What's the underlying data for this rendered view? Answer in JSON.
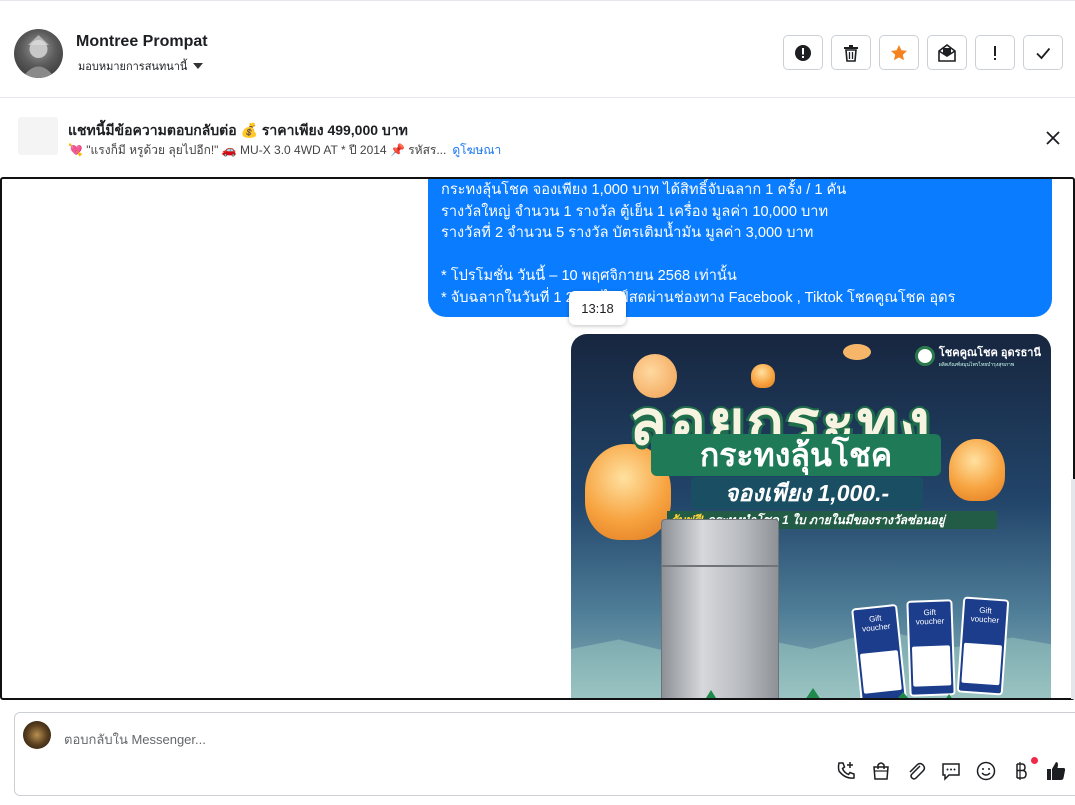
{
  "header": {
    "user_name": "Montree Prompat",
    "assign_label": "มอบหมายการสนทนานี้"
  },
  "actions": [
    {
      "name": "report-button",
      "icon": "alert-circle-icon"
    },
    {
      "name": "delete-button",
      "icon": "trash-icon"
    },
    {
      "name": "star-button",
      "icon": "star-icon",
      "color": "#f5821f"
    },
    {
      "name": "mark-unread-button",
      "icon": "mail-open-icon"
    },
    {
      "name": "important-button",
      "icon": "exclamation-icon"
    },
    {
      "name": "done-button",
      "icon": "check-icon"
    }
  ],
  "ad": {
    "title": "แชทนี้มีข้อความตอบกลับต่อ 💰 ราคาเพียง 499,000 บาท",
    "subtitle": "💘 \"แรงก็มี หรูด้วย ลุยไปอีก!\" 🚗 MU-X 3.0 4WD AT * ปี 2014 📌 รหัสร...",
    "link": "ดูโฆษณา"
  },
  "message": {
    "lines": [
      "กระทงลุ้นโชค จองเพียง 1,000 บาท ได้สิทธิ์จับฉลาก 1 ครั้ง /  1 คัน",
      "รางวัลใหญ่  จำนวน 1 รางวัล   ตู้เย็น 1  เครื่อง  มูลค่า    10,000  บาท",
      "รางวัลที่ 2  จำนวน 5 รางวัล   บัตรเติมน้ำมัน    มูลค่า    3,000   บาท",
      "",
      "* โปรโมชั่น วันนี้ – 10 พฤศจิกายน 2568 เท่านั้น",
      "* จับฉลากในวันที่ 1        2568 ไลฟ์สดผ่านช่องทาง Facebook , Tiktok โชคคูณโชค อุดร"
    ],
    "time": "13:18",
    "color": "#0a7cff"
  },
  "poster": {
    "brand": "โชคคูณโชค อุดรธานี",
    "brand_tag": "ผลิตภัณฑ์สมุนไพรไทยบำรุงสุขภาพ",
    "headline": "ลอยกระทง",
    "subheadline": "กระทงลุ้นโชค",
    "price": "จองเพียง 1,000.-",
    "free_word": "รับฟรี!",
    "free_text": "กระทงนำโชค 1 ใบ ภายในมีของรางวัลซ่อนอยู่",
    "voucher_label": "Gift voucher"
  },
  "composer": {
    "placeholder": "ตอบกลับใน Messenger..."
  },
  "tools": [
    "phone-add-icon",
    "bag-icon",
    "paperclip-icon",
    "chat-bubble-icon",
    "emoji-icon",
    "baht-icon",
    "thumbs-up-icon"
  ]
}
